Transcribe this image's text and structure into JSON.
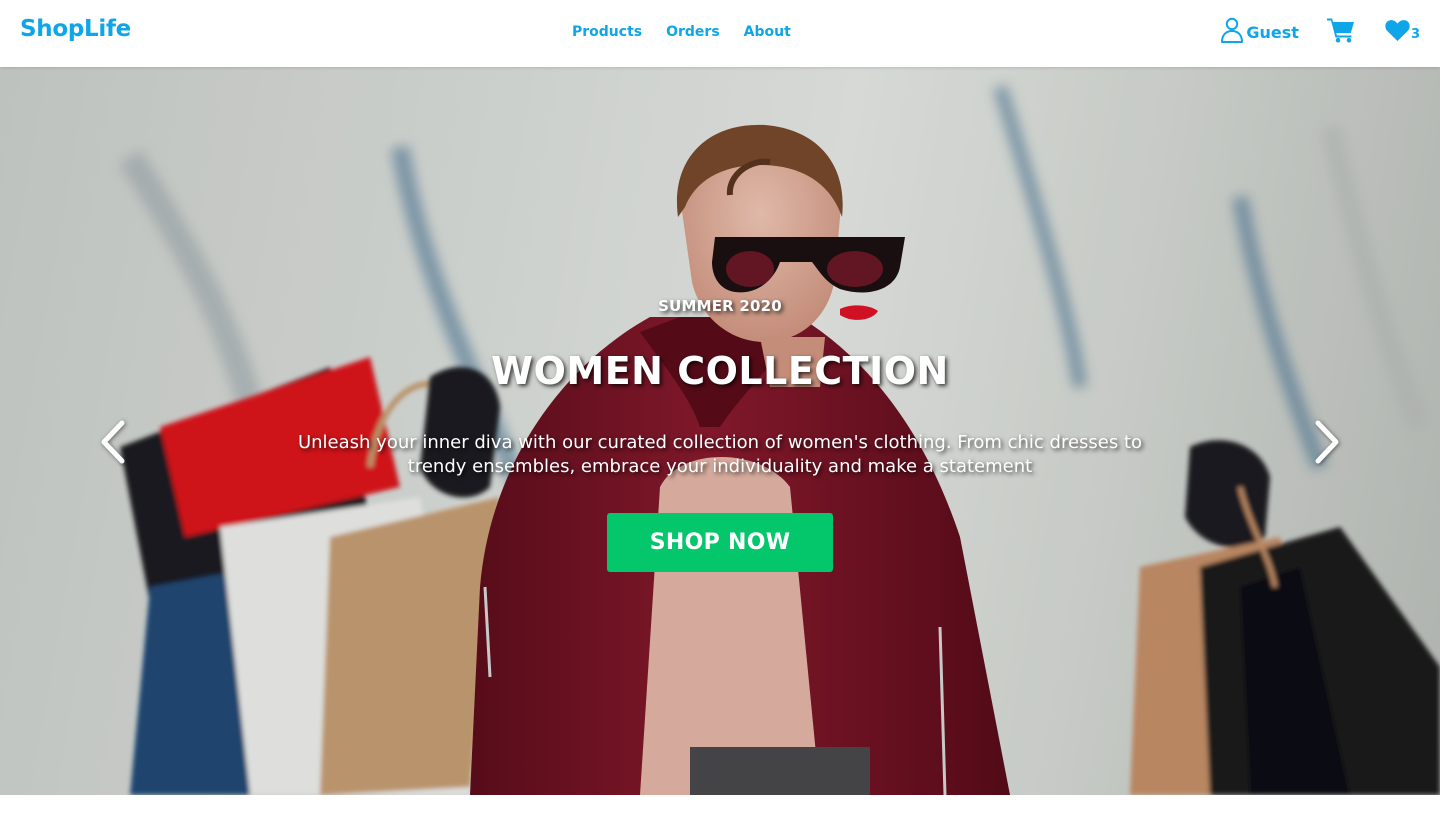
{
  "brand": {
    "name": "ShopLife"
  },
  "nav": {
    "links": [
      "Products",
      "Orders",
      "About"
    ]
  },
  "header_actions": {
    "user_label": "Guest",
    "wishlist_count": "3"
  },
  "hero": {
    "subtitle": "SUMMER 2020",
    "title": "WOMEN COLLECTION",
    "description": "Unleash your inner diva with our curated collection of women's clothing. From chic dresses to trendy ensembles, embrace your individuality and make a statement",
    "cta_label": "SHOP NOW"
  },
  "icons": {
    "user": "user-icon",
    "cart": "cart-icon",
    "wishlist": "heart-icon",
    "prev": "chevron-left-icon",
    "next": "chevron-right-icon"
  },
  "colors": {
    "accent": "#0ea5e9",
    "cta": "#04c66a",
    "coat": "#7a1426",
    "bag_red": "#e0191d"
  }
}
